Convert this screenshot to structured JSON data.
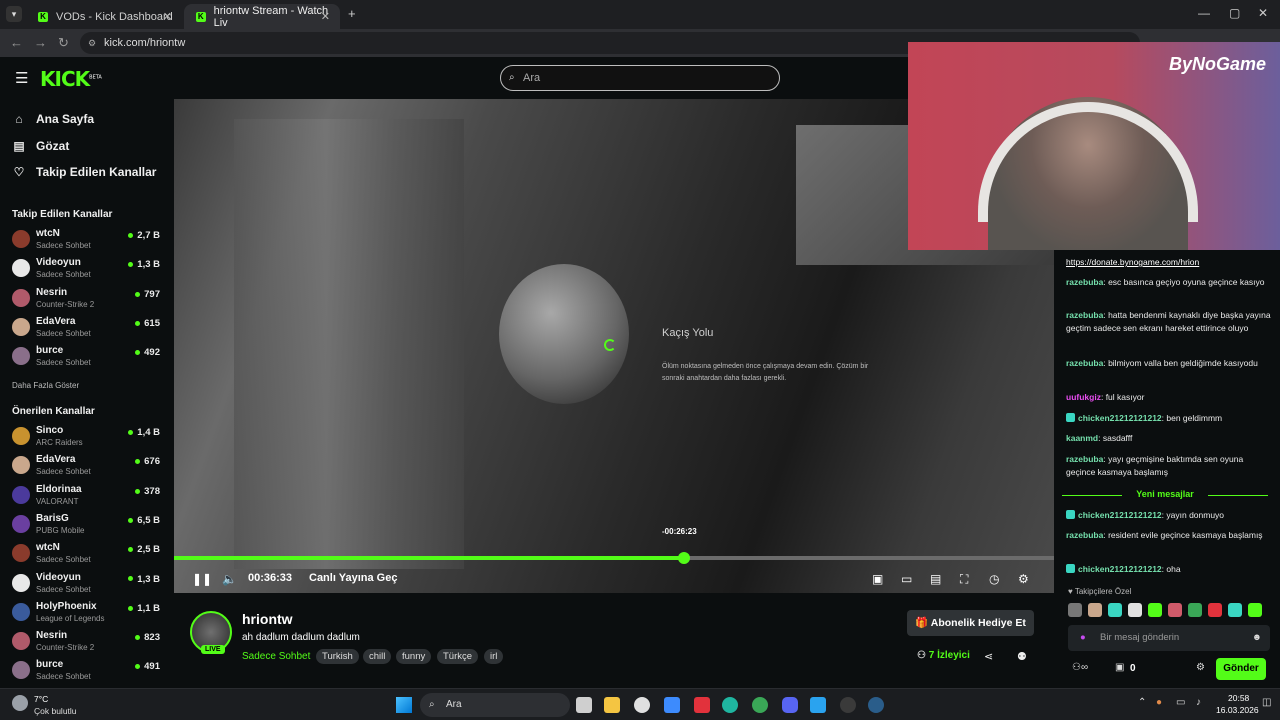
{
  "browser": {
    "tabs": [
      {
        "title": "VODs - Kick Dashboard"
      },
      {
        "title": "hriontw Stream - Watch Liv"
      }
    ],
    "url": "kick.com/hriontw"
  },
  "header": {
    "logo": "KICK",
    "logo_badge": "BETA",
    "search_placeholder": "Ara"
  },
  "sidebar": {
    "nav": [
      {
        "label": "Ana Sayfa",
        "icon": "home-icon"
      },
      {
        "label": "Gözat",
        "icon": "browse-icon"
      },
      {
        "label": "Takip Edilen Kanallar",
        "icon": "heart-icon"
      }
    ],
    "followed_heading": "Takip Edilen Kanallar",
    "followed": [
      {
        "name": "wtcN",
        "category": "Sadece Sohbet",
        "viewers": "2,7 B",
        "color": "#8a3b2c"
      },
      {
        "name": "Videoyun",
        "category": "Sadece Sohbet",
        "viewers": "1,3 B",
        "color": "#e8e8e8"
      },
      {
        "name": "Nesrin",
        "category": "Counter-Strike 2",
        "viewers": "797",
        "color": "#b05a6a"
      },
      {
        "name": "EdaVera",
        "category": "Sadece Sohbet",
        "viewers": "615",
        "color": "#c9a78c"
      },
      {
        "name": "burce",
        "category": "Sadece Sohbet",
        "viewers": "492",
        "color": "#8a6f8a"
      }
    ],
    "show_more": "Daha Fazla Göster",
    "recommended_heading": "Önerilen Kanallar",
    "recommended": [
      {
        "name": "Sinco",
        "category": "ARC Raiders",
        "viewers": "1,4 B",
        "color": "#c8922f"
      },
      {
        "name": "EdaVera",
        "category": "Sadece Sohbet",
        "viewers": "676",
        "color": "#c9a78c"
      },
      {
        "name": "Eldorinaa",
        "category": "VALORANT",
        "viewers": "378",
        "color": "#4b3a9c"
      },
      {
        "name": "BarisG",
        "category": "PUBG Mobile",
        "viewers": "6,5 B",
        "color": "#6a3fa0"
      },
      {
        "name": "wtcN",
        "category": "Sadece Sohbet",
        "viewers": "2,5 B",
        "color": "#8a3b2c"
      },
      {
        "name": "Videoyun",
        "category": "Sadece Sohbet",
        "viewers": "1,3 B",
        "color": "#e8e8e8"
      },
      {
        "name": "HolyPhoenix",
        "category": "League of Legends",
        "viewers": "1,1 B",
        "color": "#3a5b9c"
      },
      {
        "name": "Nesrin",
        "category": "Counter-Strike 2",
        "viewers": "823",
        "color": "#b05a6a"
      },
      {
        "name": "burce",
        "category": "Sadece Sohbet",
        "viewers": "491",
        "color": "#8a6f8a"
      }
    ]
  },
  "player": {
    "ingame_title": "Kaçış Yolu",
    "ingame_body": "Ölüm noktasına gelmeden önce çalışmaya devam edin. Çözüm bir sonraki anahtardan daha fazlası gerekli.",
    "hover_time": "-00:26:23",
    "time": "00:36:33",
    "go_live": "Canlı Yayına Geç",
    "progress_fraction": 0.58,
    "watermark": "ByNoGame"
  },
  "stream": {
    "username": "hriontw",
    "title": "ah dadlum dadlum dadlum",
    "live_badge": "LIVE",
    "category": "Sadece Sohbet",
    "tags": [
      "Turkish",
      "chill",
      "funny",
      "Türkçe",
      "irl"
    ],
    "gift_button": "Abonelik Hediye Et",
    "viewers": "7 İzleyici"
  },
  "chat": {
    "messages": [
      {
        "user": "",
        "text": "https://donate.bynogame.com/hrion",
        "color": "#ffffff",
        "link": true
      },
      {
        "user": "razebuba",
        "text": "esc basınca geçiyo oyuna geçince kasıyo",
        "color": "#75e0ad"
      },
      {
        "user": "razebuba",
        "text": "hatta bendenmi kaynaklı diye başka yayına geçtim sadece sen ekranı hareket ettirince oluyo",
        "color": "#75e0ad"
      },
      {
        "user": "razebuba",
        "text": "bilmiyom valla ben geldiğimde kasıyodu",
        "color": "#75e0ad"
      },
      {
        "user": "uufukgiz",
        "text": "ful kasıyor",
        "color": "#e84cf0"
      },
      {
        "user": "chicken21212121212",
        "text": "ben geldimmm",
        "color": "#75e0ad"
      },
      {
        "user": "kaanmd",
        "text": "sasdafff",
        "color": "#75e0ad"
      },
      {
        "user": "razebuba",
        "text": "yayı geçmişine baktımda sen oyuna geçince kasmaya başlamış",
        "color": "#75e0ad"
      }
    ],
    "new_messages_label": "Yeni mesajlar",
    "new_messages": [
      {
        "user": "chicken21212121212",
        "text": "yayın donmuyo",
        "color": "#75e0ad"
      },
      {
        "user": "razebuba",
        "text": "resident evile geçince kasmaya başlamış",
        "color": "#75e0ad"
      },
      {
        "user": "chicken21212121212",
        "text": "oha",
        "color": "#75e0ad"
      }
    ],
    "followers_only": "Takipçilere Özel",
    "input_placeholder": "Bir mesaj gönderin",
    "points": "0",
    "send": "Gönder"
  },
  "taskbar": {
    "temperature": "7°C",
    "weather": "Çok bulutlu",
    "search": "Ara",
    "time": "20:58",
    "date": "16.03.2026"
  }
}
